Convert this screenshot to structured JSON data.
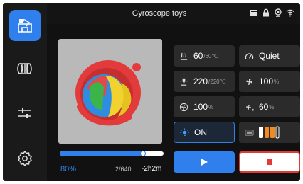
{
  "header": {
    "title": "Gyroscope toys"
  },
  "status_icons": [
    "sd-card-icon",
    "lock-icon",
    "camera-icon",
    "wifi-icon"
  ],
  "sidebar": {
    "items": [
      {
        "icon": "print-job-icon",
        "active": true
      },
      {
        "icon": "filament-spool-icon",
        "active": false
      },
      {
        "icon": "sliders-icon",
        "active": false
      },
      {
        "icon": "gear-icon",
        "active": false
      }
    ]
  },
  "print": {
    "progress_percent": 80,
    "percent_label": "80%",
    "layers": "2/640",
    "remaining": "-2h2m"
  },
  "tiles": {
    "bed_temp": {
      "value": "60",
      "target": "/60℃"
    },
    "speed": {
      "value": "Quiet"
    },
    "nozzle_temp": {
      "value": "220",
      "target": "/220℃"
    },
    "part_fan": {
      "value": "100",
      "unit": "%"
    },
    "aux_fan": {
      "value": "100",
      "unit": "%"
    },
    "chamber_fan": {
      "value": "60",
      "unit": "%"
    },
    "light": {
      "value": "ON"
    }
  },
  "colors": {
    "accent": "#2f80ed",
    "stop": "#e53935",
    "ams_orange": "#f28b1e"
  }
}
